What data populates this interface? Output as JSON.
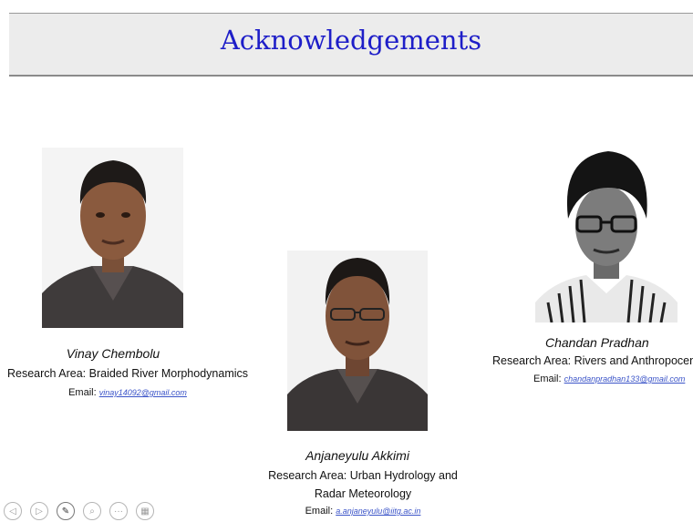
{
  "title": "Acknowledgements",
  "people": [
    {
      "name": "Vinay Chembolu",
      "area": "Research Area: Braided River Morphodynamics",
      "email_label": "Email:",
      "email": "vinay14092@gmail.com"
    },
    {
      "name": "Anjaneyulu Akkimi",
      "area_line1": "Research Area: Urban Hydrology and",
      "area_line2": "Radar Meteorology",
      "email_label": "Email:",
      "email": "a.anjaneyulu@iitg.ac.in"
    },
    {
      "name": "Chandan Pradhan",
      "area": "Research Area: Rivers and Anthropocene",
      "email_label": "Email:",
      "email": "chandanpradhan133@gmail.com"
    }
  ],
  "controls": [
    {
      "icon": "prev-icon",
      "glyph": "◁"
    },
    {
      "icon": "play-icon",
      "glyph": "▷"
    },
    {
      "icon": "pen-icon",
      "glyph": "✎"
    },
    {
      "icon": "zoom-icon",
      "glyph": "⌕"
    },
    {
      "icon": "more-icon",
      "glyph": "···"
    },
    {
      "icon": "slides-icon",
      "glyph": "▦"
    }
  ]
}
